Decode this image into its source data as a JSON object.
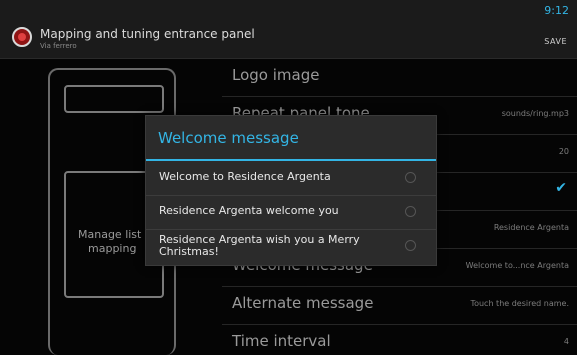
{
  "status": {
    "time": "9:12"
  },
  "actionbar": {
    "title": "Mapping and tuning entrance panel",
    "subtitle": "Via ferrero",
    "save_label": "SAVE",
    "icon": "app-logo-icon"
  },
  "panel_preview": {
    "manage_label_line1": "Manage list",
    "manage_label_line2": "mapping"
  },
  "settings": [
    {
      "title": "Logo image",
      "value": ""
    },
    {
      "title": "Repeat panel tone",
      "value": "sounds/ring.mp3"
    },
    {
      "title": "",
      "value": "20"
    },
    {
      "title": "",
      "value": ""
    },
    {
      "title": "",
      "value": "Residence Argenta"
    },
    {
      "title": "Welcome message",
      "value": "Welcome to...nce Argenta"
    },
    {
      "title": "Alternate message",
      "value": "Touch the desired name."
    },
    {
      "title": "Time interval",
      "value": "4"
    }
  ],
  "dialog": {
    "title": "Welcome message",
    "options": [
      {
        "label": "Welcome to Residence Argenta"
      },
      {
        "label": "Residence Argenta welcome you"
      },
      {
        "label": "Residence Argenta wish you a Merry Christmas!"
      }
    ]
  },
  "colors": {
    "accent": "#33b5e5",
    "background": "#050505"
  }
}
